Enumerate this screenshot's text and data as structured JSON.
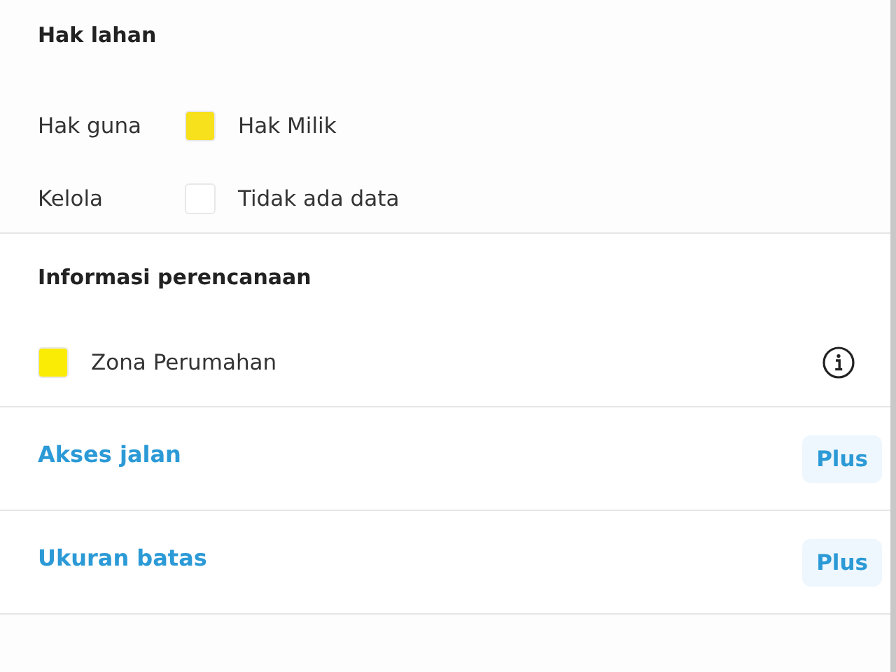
{
  "land_rights": {
    "title": "Hak lahan",
    "rows": [
      {
        "label": "Hak guna",
        "color": "#f7e01c",
        "value": "Hak Milik"
      },
      {
        "label": "Kelola",
        "color": "#ffffff",
        "value": "Tidak ada data"
      }
    ]
  },
  "planning": {
    "title": "Informasi perencanaan",
    "zone": {
      "color": "#fbec06",
      "name": "Zona Perumahan"
    }
  },
  "upgrades": [
    {
      "label": "Akses jalan",
      "badge": "Plus"
    },
    {
      "label": "Ukuran batas",
      "badge": "Plus"
    }
  ]
}
